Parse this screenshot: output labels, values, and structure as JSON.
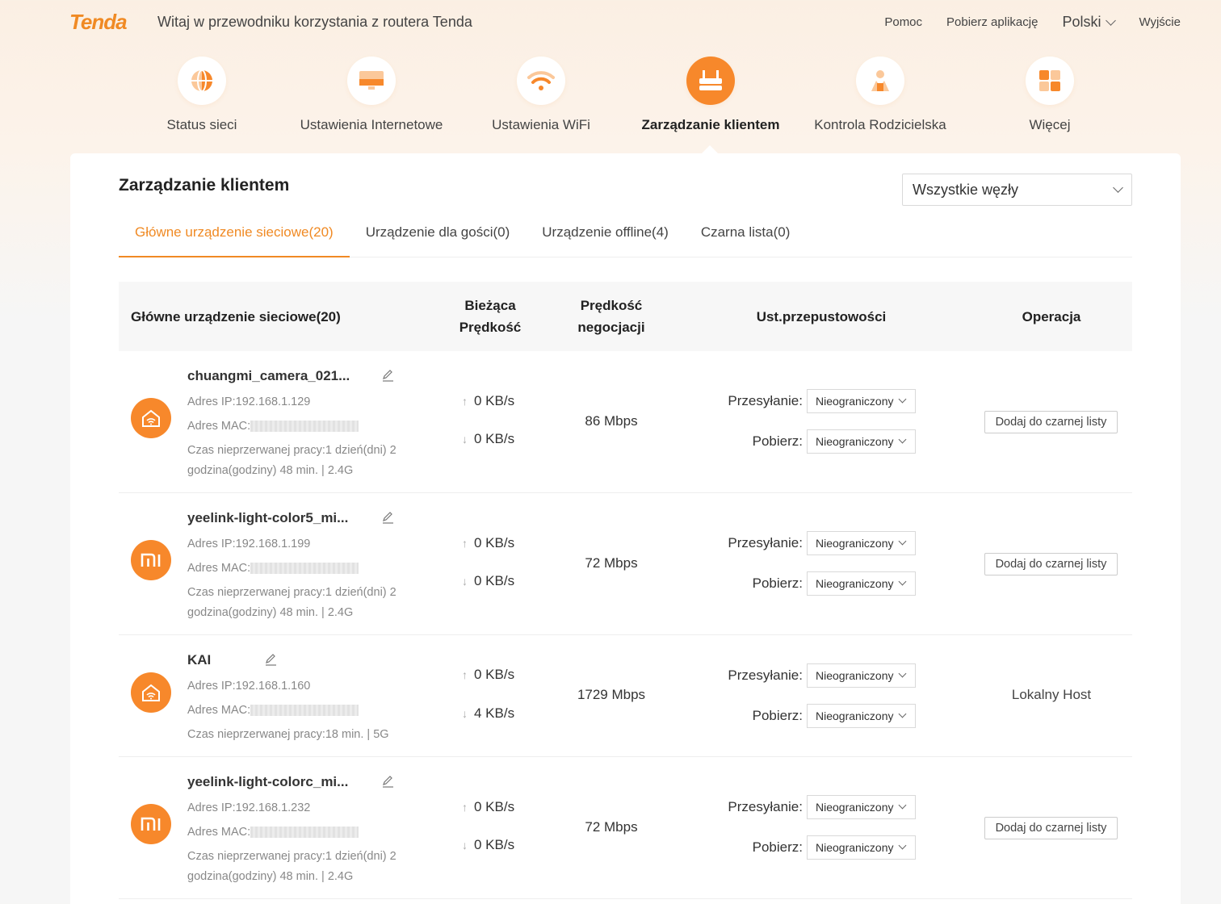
{
  "header": {
    "logo": "Tenda",
    "welcome": "Witaj w przewodniku korzystania z routera Tenda",
    "help": "Pomoc",
    "download_app": "Pobierz aplikację",
    "language": "Polski",
    "logout": "Wyjście"
  },
  "nav": [
    {
      "label": "Status sieci",
      "icon": "globe-icon"
    },
    {
      "label": "Ustawienia Internetowe",
      "icon": "monitor-icon"
    },
    {
      "label": "Ustawienia WiFi",
      "icon": "wifi-icon"
    },
    {
      "label": "Zarządzanie klientem",
      "icon": "router-icon",
      "active": true
    },
    {
      "label": "Kontrola Rodzicielska",
      "icon": "parental-icon"
    },
    {
      "label": "Więcej",
      "icon": "grid-icon"
    }
  ],
  "panel": {
    "title": "Zarządzanie klientem",
    "node_select": "Wszystkie węzły"
  },
  "tabs": [
    {
      "label": "Główne urządzenie sieciowe(20)",
      "active": true
    },
    {
      "label": "Urządzenie dla gości(0)"
    },
    {
      "label": "Urządzenie offline(4)"
    },
    {
      "label": "Czarna lista(0)"
    }
  ],
  "table": {
    "headers": {
      "device": "Główne urządzenie sieciowe(20)",
      "current_speed_1": "Bieżąca",
      "current_speed_2": "Prędkość",
      "negotiated_1": "Prędkość",
      "negotiated_2": "negocjacji",
      "bandwidth": "Ust.przepustowości",
      "operation": "Operacja"
    },
    "upload_label": "Przesyłanie:",
    "download_label": "Pobierz:",
    "bandwidth_value": "Nieograniczony",
    "blacklist_button": "Dodaj do czarnej listy",
    "rows": [
      {
        "name": "chuangmi_camera_021...",
        "icon": "home-wifi-icon",
        "ip": "Adres IP:192.168.1.129",
        "mac_label": "Adres MAC:",
        "uptime_1": "Czas nieprzerwanej pracy:1 dzień(dni) 2",
        "uptime_2": "godzina(godziny) 48 min. | 2.4G",
        "up": "0 KB/s",
        "down": "0 KB/s",
        "negotiated": "86 Mbps",
        "operation": "button"
      },
      {
        "name": "yeelink-light-color5_mi...",
        "icon": "mi-icon",
        "ip": "Adres IP:192.168.1.199",
        "mac_label": "Adres MAC:",
        "uptime_1": "Czas nieprzerwanej pracy:1 dzień(dni) 2",
        "uptime_2": "godzina(godziny) 48 min. | 2.4G",
        "up": "0 KB/s",
        "down": "0 KB/s",
        "negotiated": "72 Mbps",
        "operation": "button"
      },
      {
        "name": "KAI",
        "icon": "home-wifi-icon",
        "ip": "Adres IP:192.168.1.160",
        "mac_label": "Adres MAC:",
        "uptime_1": "Czas nieprzerwanej pracy:18 min. | 5G",
        "uptime_2": "",
        "up": "0 KB/s",
        "down": "4 KB/s",
        "negotiated": "1729 Mbps",
        "operation": "Lokalny Host"
      },
      {
        "name": "yeelink-light-colorc_mi...",
        "icon": "mi-icon",
        "ip": "Adres IP:192.168.1.232",
        "mac_label": "Adres MAC:",
        "uptime_1": "Czas nieprzerwanej pracy:1 dzień(dni) 2",
        "uptime_2": "godzina(godziny) 48 min. | 2.4G",
        "up": "0 KB/s",
        "down": "0 KB/s",
        "negotiated": "72 Mbps",
        "operation": "button"
      }
    ]
  },
  "colors": {
    "accent": "#f08a24",
    "icon_bg": "#f7882b"
  }
}
